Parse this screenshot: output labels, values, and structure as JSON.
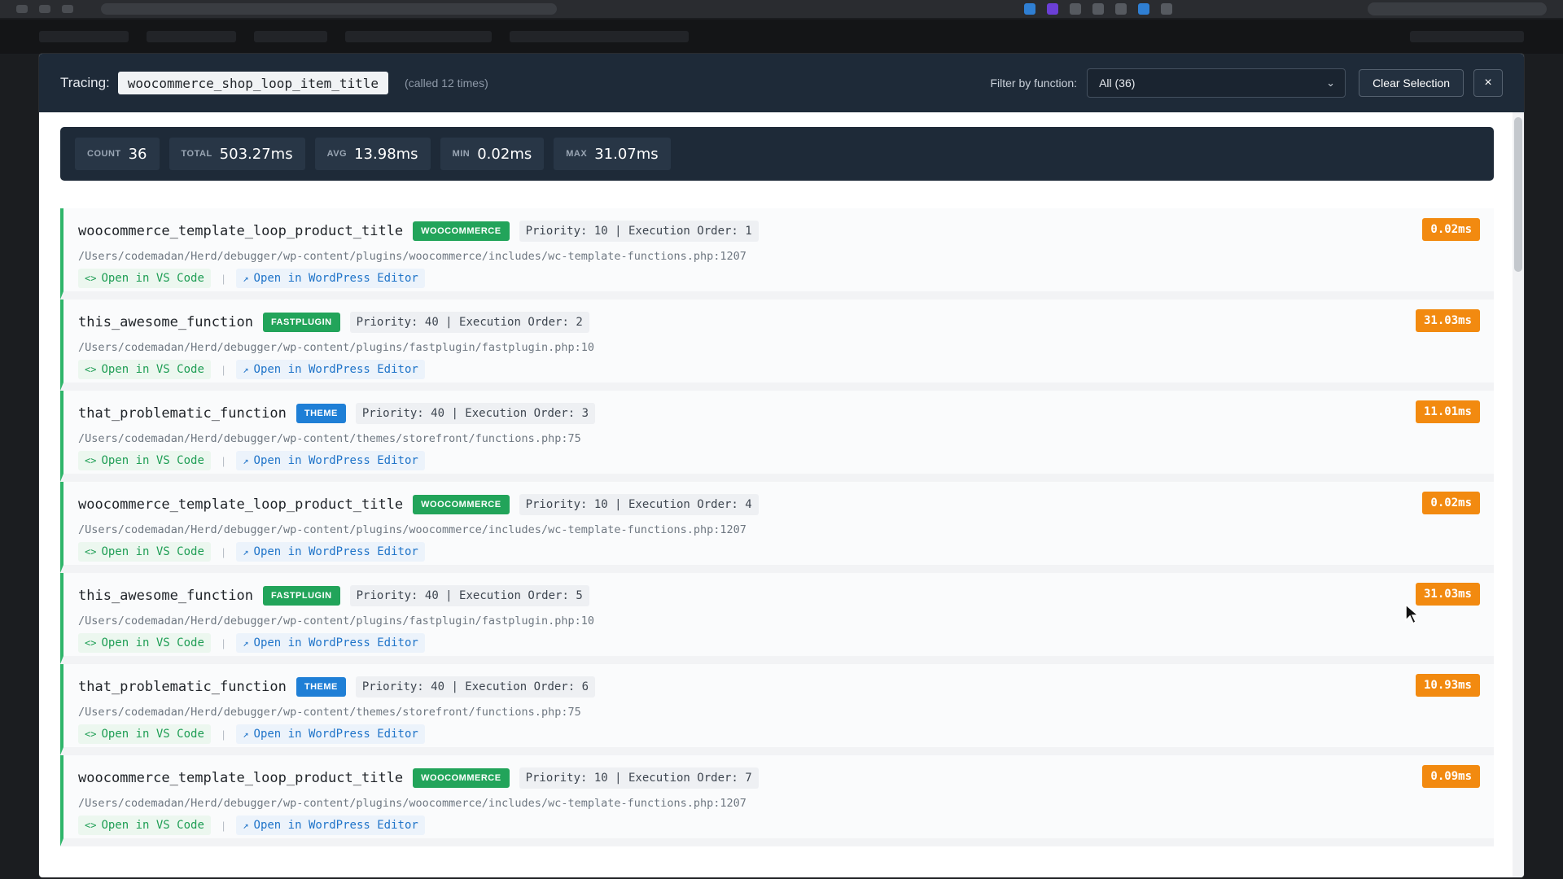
{
  "header": {
    "tracing_label": "Tracing:",
    "hook_name": "woocommerce_shop_loop_item_title",
    "called_count": "(called 12 times)",
    "filter_label": "Filter by function:",
    "filter_value": "All (36)",
    "clear_label": "Clear Selection",
    "close_label": "×"
  },
  "stats": {
    "count_label": "COUNT",
    "count_value": "36",
    "total_label": "TOTAL",
    "total_value": "503.27ms",
    "avg_label": "AVG",
    "avg_value": "13.98ms",
    "min_label": "MIN",
    "min_value": "0.02ms",
    "max_label": "MAX",
    "max_value": "31.07ms"
  },
  "link_labels": {
    "vscode": "Open in VS Code",
    "wp": "Open in WordPress Editor",
    "separator": "|"
  },
  "entries": [
    {
      "fn": "woocommerce_template_loop_product_title",
      "badge": "WOOCOMMERCE",
      "badge_type": "woocommerce",
      "meta": "Priority: 10 | Execution Order: 1",
      "path": "/Users/codemadan/Herd/debugger/wp-content/plugins/woocommerce/includes/wc-template-functions.php:1207",
      "duration": "0.02ms"
    },
    {
      "fn": "this_awesome_function",
      "badge": "FASTPLUGIN",
      "badge_type": "fastplugin",
      "meta": "Priority: 40 | Execution Order: 2",
      "path": "/Users/codemadan/Herd/debugger/wp-content/plugins/fastplugin/fastplugin.php:10",
      "duration": "31.03ms"
    },
    {
      "fn": "that_problematic_function",
      "badge": "THEME",
      "badge_type": "theme",
      "meta": "Priority: 40 | Execution Order: 3",
      "path": "/Users/codemadan/Herd/debugger/wp-content/themes/storefront/functions.php:75",
      "duration": "11.01ms"
    },
    {
      "fn": "woocommerce_template_loop_product_title",
      "badge": "WOOCOMMERCE",
      "badge_type": "woocommerce",
      "meta": "Priority: 10 | Execution Order: 4",
      "path": "/Users/codemadan/Herd/debugger/wp-content/plugins/woocommerce/includes/wc-template-functions.php:1207",
      "duration": "0.02ms"
    },
    {
      "fn": "this_awesome_function",
      "badge": "FASTPLUGIN",
      "badge_type": "fastplugin",
      "meta": "Priority: 40 | Execution Order: 5",
      "path": "/Users/codemadan/Herd/debugger/wp-content/plugins/fastplugin/fastplugin.php:10",
      "duration": "31.03ms"
    },
    {
      "fn": "that_problematic_function",
      "badge": "THEME",
      "badge_type": "theme",
      "meta": "Priority: 40 | Execution Order: 6",
      "path": "/Users/codemadan/Herd/debugger/wp-content/themes/storefront/functions.php:75",
      "duration": "10.93ms"
    },
    {
      "fn": "woocommerce_template_loop_product_title",
      "badge": "WOOCOMMERCE",
      "badge_type": "woocommerce",
      "meta": "Priority: 10 | Execution Order: 7",
      "path": "/Users/codemadan/Herd/debugger/wp-content/plugins/woocommerce/includes/wc-template-functions.php:1207",
      "duration": "0.09ms"
    }
  ],
  "colors": {
    "header_bg": "#1e2a38",
    "success_green": "#22a45a",
    "theme_blue": "#1f7fd6",
    "duration_orange": "#f28a10"
  },
  "icons": {
    "code": "code-icon",
    "external": "external-link-icon",
    "chevron": "chevron-down-icon",
    "close": "close-icon"
  }
}
